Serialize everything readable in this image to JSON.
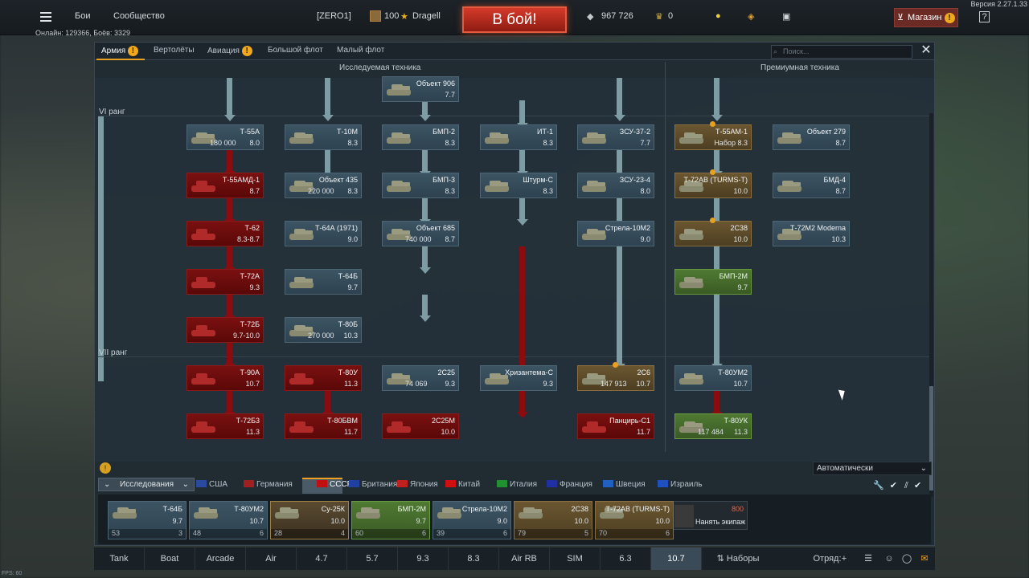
{
  "version": "Версия 2.27.1.33",
  "top": {
    "menu_battles": "Бои",
    "menu_community": "Сообщество",
    "clan_tag": "[ZERO1]",
    "level": "100",
    "nickname": "Dragell",
    "fight_button": "В бой!",
    "silver_lions": "967 726",
    "golden_eagles": "0",
    "shop": "Магазин",
    "help": "?"
  },
  "online": "Онлайн: 129366, Боёв: 3329",
  "tabs": [
    {
      "label": "Армия",
      "active": true,
      "alert": true
    },
    {
      "label": "Вертолёты"
    },
    {
      "label": "Авиация",
      "alert": true
    },
    {
      "label": "Большой флот"
    },
    {
      "label": "Малый флот"
    }
  ],
  "search_placeholder": "Поиск...",
  "headers": {
    "researched": "Исследуемая техника",
    "premium": "Премиумная техника"
  },
  "ranks": [
    "VI ранг",
    "VII ранг"
  ],
  "vehicles": [
    {
      "name": "Объект 906",
      "br": "7.7",
      "type": "normal"
    },
    {
      "name": "Т-55А",
      "cost": "180 000",
      "br": "8.0",
      "type": "normal"
    },
    {
      "name": "Т-10М",
      "br": "8.3",
      "type": "normal"
    },
    {
      "name": "БМП-2",
      "br": "8.3",
      "type": "normal"
    },
    {
      "name": "ИТ-1",
      "br": "8.3",
      "type": "normal"
    },
    {
      "name": "ЗСУ-37-2",
      "br": "7.7",
      "type": "normal"
    },
    {
      "name": "Т-55АМ-1",
      "br": "Набор 8.3",
      "type": "gold"
    },
    {
      "name": "Объект 279",
      "br": "8.7",
      "type": "normal"
    },
    {
      "name": "Т-55АМД-1",
      "br": "8.7",
      "type": "red"
    },
    {
      "name": "Объект 435",
      "cost": "220 000",
      "br": "8.3",
      "type": "normal"
    },
    {
      "name": "БМП-3",
      "br": "8.3",
      "type": "normal"
    },
    {
      "name": "Штурм-С",
      "br": "8.3",
      "type": "normal"
    },
    {
      "name": "ЗСУ-23-4",
      "br": "8.0",
      "type": "normal"
    },
    {
      "name": "Т-72АВ (TURMS-T)",
      "br": "10.0",
      "type": "gold"
    },
    {
      "name": "БМД-4",
      "br": "8.7",
      "type": "normal"
    },
    {
      "name": "Т-62",
      "br": "8.3-8.7",
      "type": "red"
    },
    {
      "name": "Т-64А (1971)",
      "br": "9.0",
      "type": "normal"
    },
    {
      "name": "Объект 685",
      "cost": "740 000",
      "br": "8.7",
      "type": "normal"
    },
    {
      "name": "Стрела-10М2",
      "br": "9.0",
      "type": "normal"
    },
    {
      "name": "2С38",
      "br": "10.0",
      "type": "gold"
    },
    {
      "name": "Т-72М2 Moderna",
      "br": "10.3",
      "type": "normal"
    },
    {
      "name": "Т-72А",
      "br": "9.3",
      "type": "red"
    },
    {
      "name": "Т-64Б",
      "br": "9.7",
      "type": "normal"
    },
    {
      "name": "БМП-2М",
      "br": "9.7",
      "type": "green"
    },
    {
      "name": "Т-72Б",
      "br": "9.7-10.0",
      "type": "red"
    },
    {
      "name": "Т-80Б",
      "cost": "270 000",
      "br": "10.3",
      "type": "normal"
    },
    {
      "name": "Т-90А",
      "br": "10.7",
      "type": "red"
    },
    {
      "name": "Т-80У",
      "br": "11.3",
      "type": "red"
    },
    {
      "name": "2С25",
      "cost": "74 069",
      "br": "9.3",
      "type": "normal"
    },
    {
      "name": "Хризантема-С",
      "br": "9.3",
      "type": "normal"
    },
    {
      "name": "2С6",
      "cost": "147 913",
      "br": "10.7",
      "type": "gold"
    },
    {
      "name": "Т-80УМ2",
      "br": "10.7",
      "type": "normal"
    },
    {
      "name": "Т-72Б3",
      "br": "11.3",
      "type": "red"
    },
    {
      "name": "Т-80БВМ",
      "br": "11.7",
      "type": "red"
    },
    {
      "name": "2С25М",
      "br": "10.0",
      "type": "red"
    },
    {
      "name": "Панцирь-С1",
      "br": "11.7",
      "type": "red"
    },
    {
      "name": "Т-80УК",
      "cost": "117 484",
      "br": "11.3",
      "type": "green"
    }
  ],
  "autoselect": "Автоматически",
  "research_label": "Исследования",
  "nations": [
    "США",
    "Германия",
    "СССР",
    "Британия",
    "Япония",
    "Китай",
    "Италия",
    "Франция",
    "Швеция",
    "Израиль"
  ],
  "crew": [
    {
      "name": "Т-64Б",
      "br": "9.7",
      "left": "53",
      "right": "3"
    },
    {
      "name": "Т-80УМ2",
      "br": "10.7",
      "left": "48",
      "right": "6"
    },
    {
      "name": "Су-25К",
      "br": "10.0",
      "left": "28",
      "right": "4"
    },
    {
      "name": "БМП-2М",
      "br": "9.7",
      "left": "60",
      "right": "6"
    },
    {
      "name": "Стрела-10М2",
      "br": "9.0",
      "left": "39",
      "right": "6"
    },
    {
      "name": "2С38",
      "br": "10.0",
      "left": "79",
      "right": "5"
    },
    {
      "name": "Т-72АВ (TURMS-T)",
      "br": "10.0",
      "left": "70",
      "right": "6"
    }
  ],
  "hire": {
    "cost": "800",
    "label": "Нанять экипаж"
  },
  "bottom": {
    "items": [
      "Tank",
      "Boat",
      "Arcade",
      "Air",
      "4.7",
      "5.7",
      "9.3",
      "8.3",
      "Air RB",
      "SIM",
      "6.3",
      "10.7"
    ],
    "presets": "Наборы",
    "squad": "Отряд:"
  },
  "fps": "FPS: 60"
}
